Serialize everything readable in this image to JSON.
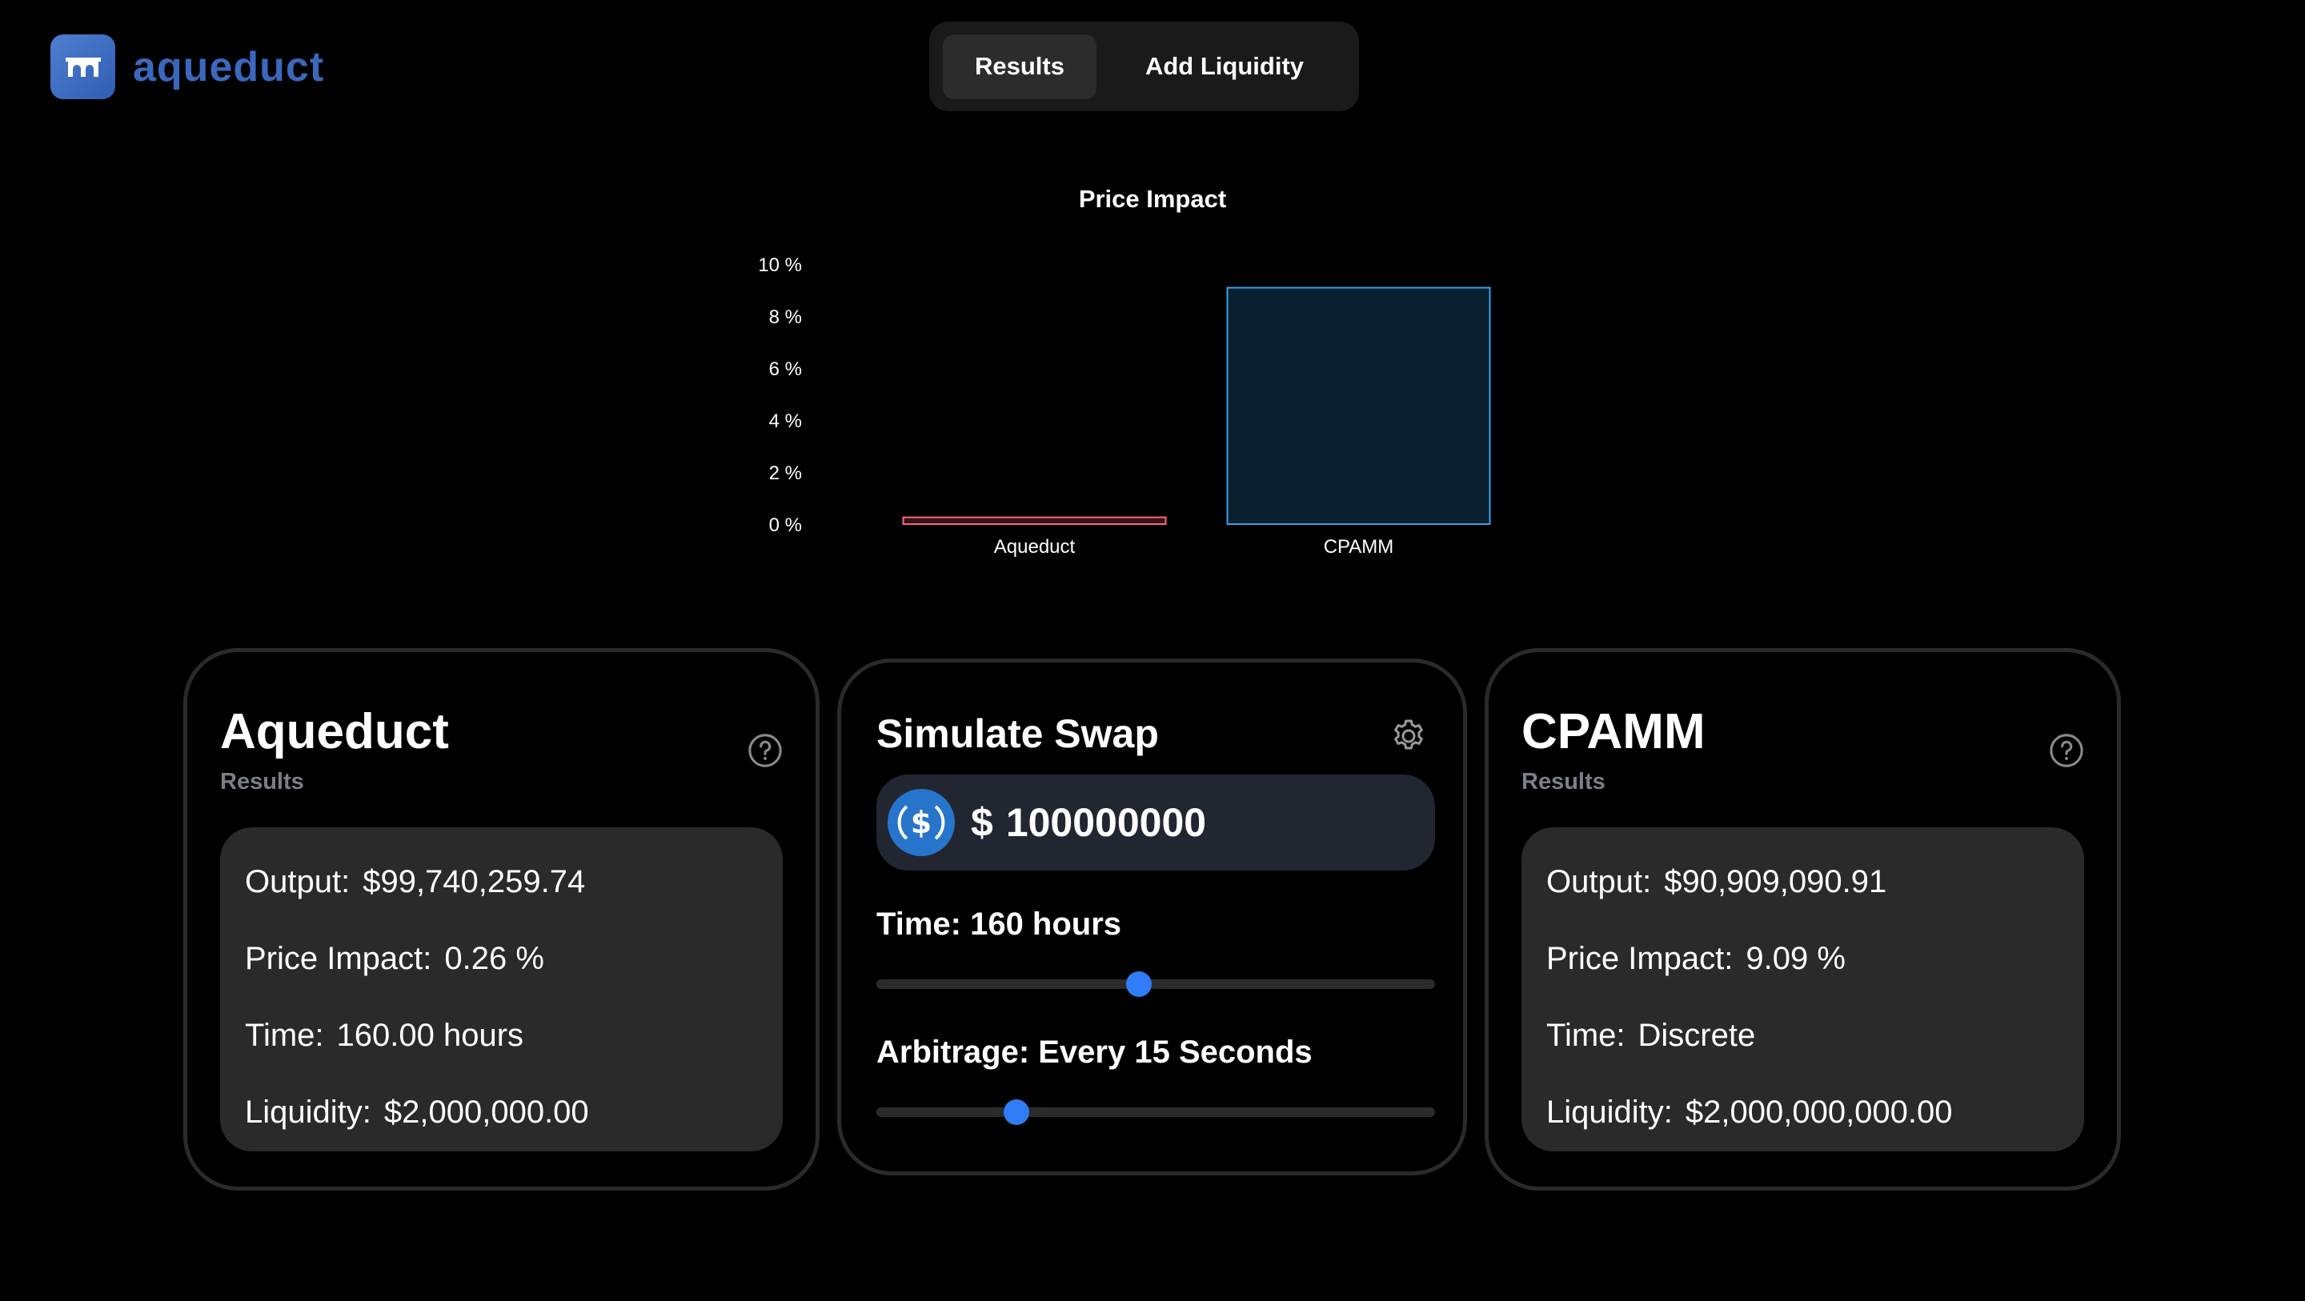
{
  "app": {
    "name": "aqueduct",
    "brand_color": "#3a68bd"
  },
  "tabs": [
    {
      "label": "Results",
      "active": true
    },
    {
      "label": "Add Liquidity",
      "active": false
    }
  ],
  "chart_data": {
    "type": "bar",
    "title": "Price Impact",
    "categories": [
      "Aqueduct",
      "CPAMM"
    ],
    "values": [
      0.26,
      9.09
    ],
    "ylim": [
      0,
      10
    ],
    "yticks": [
      "0 %",
      "2 %",
      "4 %",
      "6 %",
      "8 %",
      "10 %"
    ],
    "colors": {
      "Aqueduct": "#ff6384",
      "CPAMM": "#36a2eb"
    },
    "grid": false
  },
  "aqueduct_card": {
    "title": "Aqueduct",
    "subtitle": "Results",
    "icon": "help-circle-icon",
    "rows": [
      {
        "label": "Output:",
        "value": "$99,740,259.74"
      },
      {
        "label": "Price Impact:",
        "value": "0.26 %"
      },
      {
        "label": "Time:",
        "value": "160.00 hours"
      },
      {
        "label": "Liquidity:",
        "value": "$2,000,000.00"
      }
    ]
  },
  "simulate_swap": {
    "title": "Simulate Swap",
    "settings_icon": "gear-icon",
    "token_icon": "usdc-icon",
    "currency_symbol": "$",
    "amount": "100000000",
    "time_label": "Time: 160 hours",
    "time_slider_fraction": 0.47,
    "arbitrage_label": "Arbitrage: Every 15 Seconds",
    "arbitrage_slider_fraction": 0.25,
    "accent_color": "#2f7cf6"
  },
  "cpamm_card": {
    "title": "CPAMM",
    "subtitle": "Results",
    "icon": "help-circle-icon",
    "rows": [
      {
        "label": "Output:",
        "value": "$90,909,090.91"
      },
      {
        "label": "Price Impact:",
        "value": "9.09 %"
      },
      {
        "label": "Time:",
        "value": "Discrete"
      },
      {
        "label": "Liquidity:",
        "value": "$2,000,000,000.00"
      }
    ]
  }
}
